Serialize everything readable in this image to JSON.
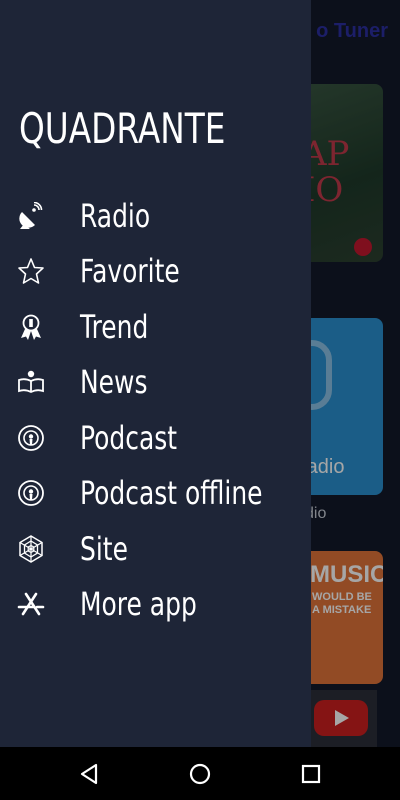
{
  "background": {
    "app_title": "o Tuner",
    "card1_text": "AP\nIO",
    "card2_label": "radio",
    "card2_caption": "dio",
    "card3_text": "MUSIC,",
    "card3_sub": "WOULD BE\nA MISTAKE"
  },
  "drawer": {
    "brand": "QUADRANTE",
    "items": [
      {
        "label": "Radio",
        "icon": "satellite-dish-icon"
      },
      {
        "label": "Favorite",
        "icon": "star-icon"
      },
      {
        "label": "Trend",
        "icon": "award-ribbon-icon"
      },
      {
        "label": "News",
        "icon": "reader-icon"
      },
      {
        "label": "Podcast",
        "icon": "podcast-icon"
      },
      {
        "label": "Podcast offline",
        "icon": "podcast-icon"
      },
      {
        "label": "Site",
        "icon": "web-icon"
      },
      {
        "label": "More app",
        "icon": "app-store-icon"
      }
    ]
  },
  "navbar": {
    "back": "back-icon",
    "home": "home-icon",
    "recent": "recent-apps-icon"
  },
  "colors": {
    "drawer_bg": "#1e2537",
    "text": "#ffffff",
    "accent_title": "#2b2fa0"
  }
}
